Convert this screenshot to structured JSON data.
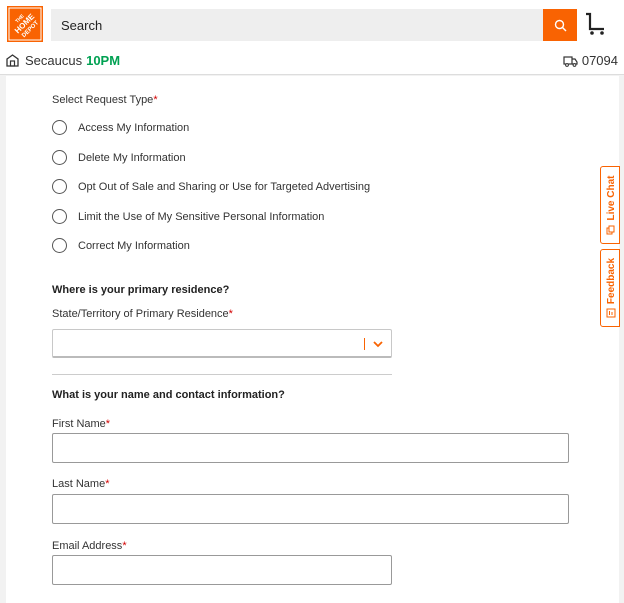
{
  "header": {
    "logo_icon": "home-depot-logo-icon",
    "search": {
      "placeholder": "Search",
      "value": ""
    },
    "colors": {
      "brand_orange": "#f96302"
    }
  },
  "store": {
    "name": "Secaucus",
    "hours": "10PM",
    "zip": "07094"
  },
  "form": {
    "request_type_label": "Select Request Type",
    "required_mark": "*",
    "request_types": [
      "Access My Information",
      "Delete My Information",
      "Opt Out of Sale and Sharing or Use for Targeted Advertising",
      "Limit the Use of My Sensitive Personal Information",
      "Correct My Information"
    ],
    "residence_heading": "Where is your primary residence?",
    "state_label": "State/Territory of Primary Residence",
    "state_value": "",
    "contact_heading": "What is your name and contact information?",
    "first_name_label": "First Name",
    "last_name_label": "Last Name",
    "email_label": "Email Address"
  },
  "side_tabs": {
    "live_chat": "Live Chat",
    "feedback": "Feedback"
  }
}
